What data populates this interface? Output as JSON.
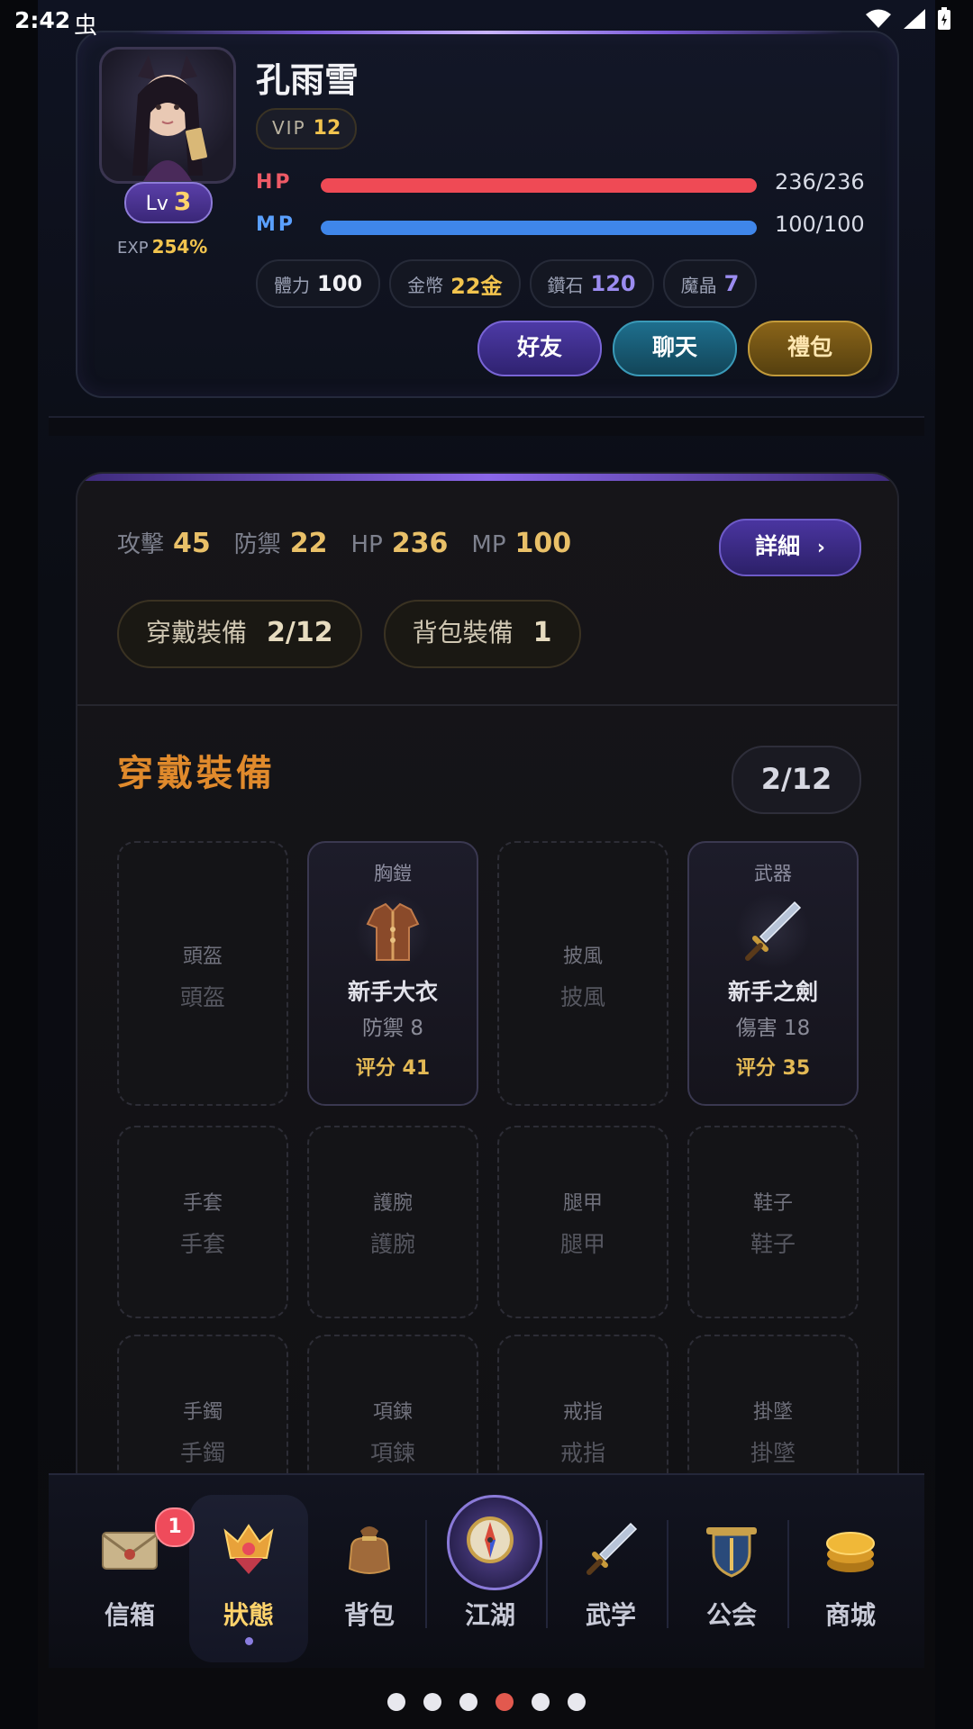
{
  "status_bar": {
    "time": "2:42",
    "bug_glyph": "虫"
  },
  "profile": {
    "name": "孔雨雪",
    "vip_label": "VIP",
    "vip_level": "12",
    "level_label": "Lv",
    "level": "3",
    "exp_label": "EXP",
    "exp_value": "254%",
    "hp": {
      "label": "HP",
      "value": "236/236",
      "fraction": 1.0,
      "color": "#ef4a55"
    },
    "mp": {
      "label": "MP",
      "value": "100/100",
      "fraction": 1.0,
      "color": "#3f86ea"
    },
    "currencies": [
      {
        "label": "體力",
        "value": "100",
        "color": "#f0f0f4"
      },
      {
        "label": "金幣",
        "value": "22金",
        "color": "#f2c44e"
      },
      {
        "label": "鑽石",
        "value": "120",
        "color": "#9b8cf0"
      },
      {
        "label": "魔晶",
        "value": "7",
        "color": "#9b8cf0"
      }
    ],
    "buttons": {
      "friend": "好友",
      "chat": "聊天",
      "gift": "禮包"
    }
  },
  "status_panel": {
    "stats": [
      {
        "label": "攻擊",
        "value": "45"
      },
      {
        "label": "防禦",
        "value": "22"
      },
      {
        "label": "HP",
        "value": "236"
      },
      {
        "label": "MP",
        "value": "100"
      }
    ],
    "detail_button": "詳細",
    "detail_arrow": "›",
    "tabs": [
      {
        "label": "穿戴裝備",
        "value": "2/12"
      },
      {
        "label": "背包裝備",
        "value": "1"
      }
    ],
    "section_title": "穿戴裝備",
    "section_count": "2/12",
    "slots": [
      {
        "type": "empty",
        "line1": "頭盔",
        "line2": "頭盔"
      },
      {
        "type": "filled",
        "category": "胸鎧",
        "name": "新手大衣",
        "stat": "防禦 8",
        "score": "评分 41",
        "icon": "armor-icon"
      },
      {
        "type": "empty",
        "line1": "披風",
        "line2": "披風"
      },
      {
        "type": "filled",
        "category": "武器",
        "name": "新手之劍",
        "stat": "傷害 18",
        "score": "评分 35",
        "icon": "sword-icon"
      },
      {
        "type": "empty",
        "line1": "手套",
        "line2": "手套"
      },
      {
        "type": "empty",
        "line1": "護腕",
        "line2": "護腕"
      },
      {
        "type": "empty",
        "line1": "腿甲",
        "line2": "腿甲"
      },
      {
        "type": "empty",
        "line1": "鞋子",
        "line2": "鞋子"
      },
      {
        "type": "empty",
        "line1": "手鐲",
        "line2": "手鐲"
      },
      {
        "type": "empty",
        "line1": "項鍊",
        "line2": "項鍊"
      },
      {
        "type": "empty",
        "line1": "戒指",
        "line2": "戒指"
      },
      {
        "type": "empty",
        "line1": "掛墜",
        "line2": "掛墜"
      }
    ]
  },
  "bottom_nav": [
    {
      "label": "信箱",
      "icon": "mail-icon",
      "badge": "1"
    },
    {
      "label": "狀態",
      "icon": "status-crest-icon",
      "active": true
    },
    {
      "label": "背包",
      "icon": "bag-icon"
    },
    {
      "label": "江湖",
      "icon": "compass-icon"
    },
    {
      "label": "武学",
      "icon": "sword-icon"
    },
    {
      "label": "公会",
      "icon": "guild-shield-icon"
    },
    {
      "label": "商城",
      "icon": "coins-icon"
    }
  ],
  "page_dots": {
    "count": 6,
    "active_index": 3
  }
}
